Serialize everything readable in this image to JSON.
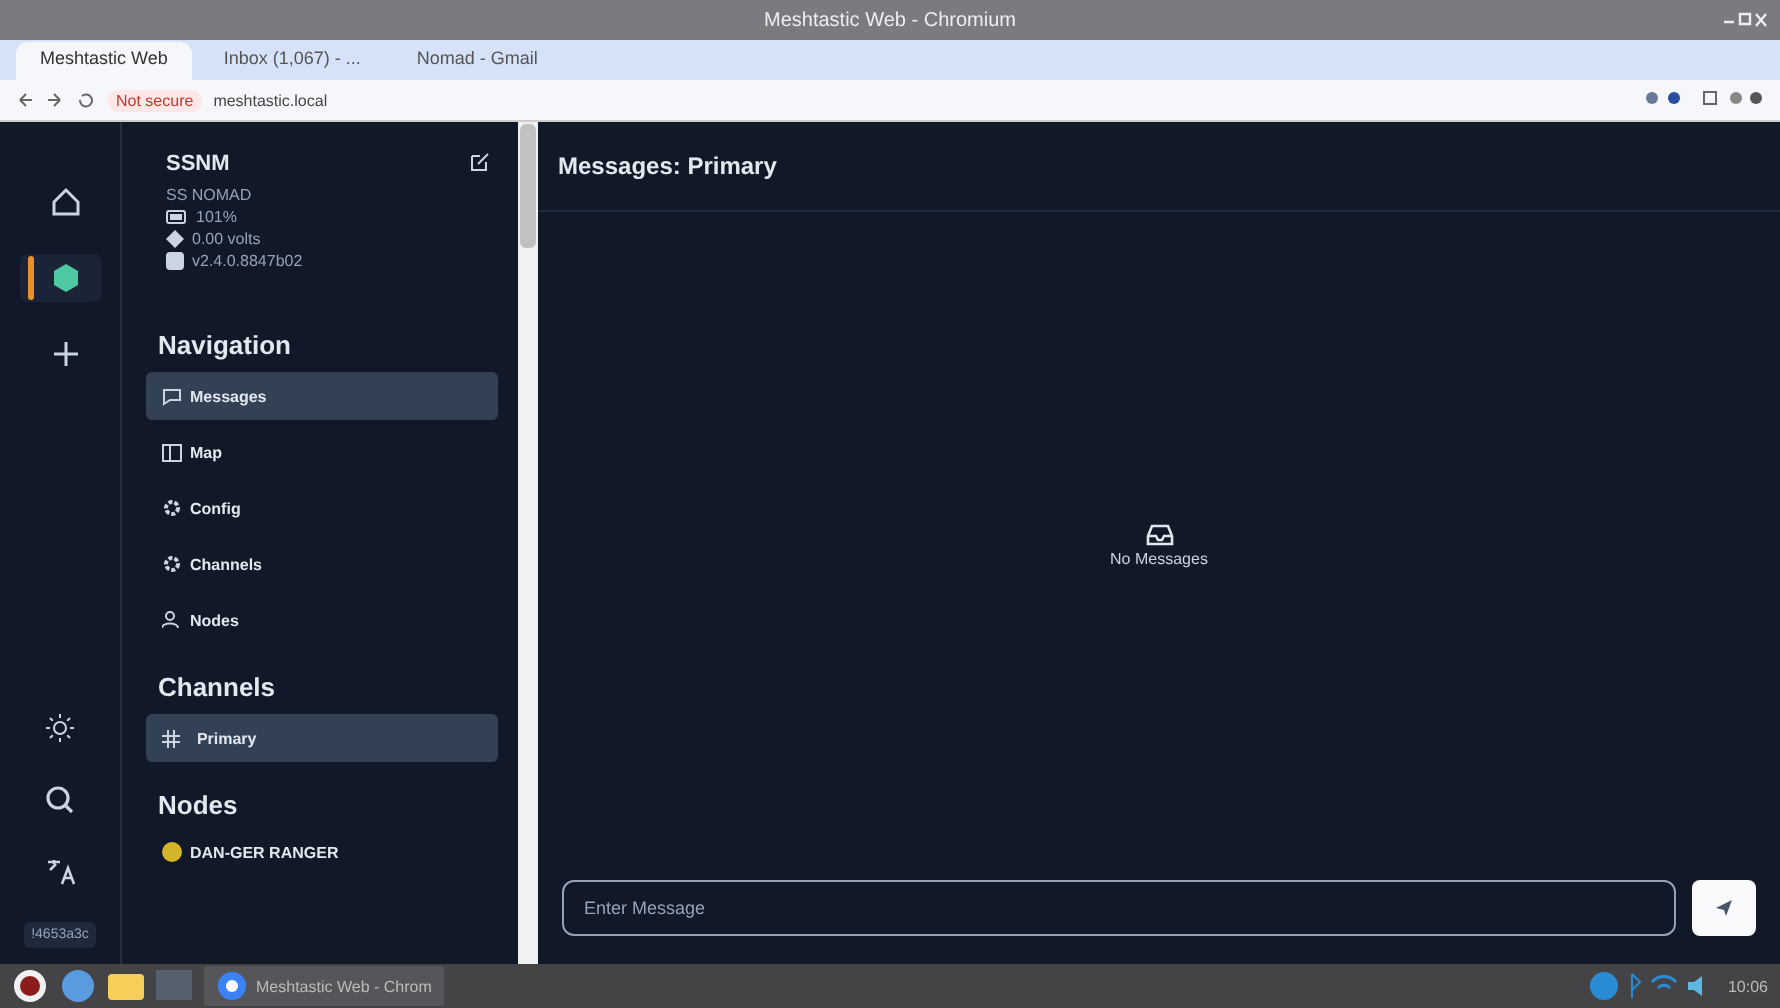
{
  "window": {
    "title": "Meshtastic Web - Chromium"
  },
  "browser_tabs": [
    {
      "label": "Meshtastic Web",
      "selected": true
    },
    {
      "label": "Inbox (1,067) - ...",
      "selected": false
    },
    {
      "label": "Nomad - Gmail",
      "selected": false
    }
  ],
  "address_bar": {
    "security": "Not secure",
    "url": "meshtastic.local"
  },
  "rail": {
    "items": [
      {
        "kind": "home",
        "selected": false
      },
      {
        "kind": "device",
        "selected": true
      },
      {
        "kind": "add",
        "selected": false
      }
    ],
    "node_id": "!4653a3c"
  },
  "device": {
    "short_name": "SSNM",
    "long_name": "SS NOMAD",
    "battery": "101%",
    "voltage": "0.00 volts",
    "firmware": "v2.4.0.8847b02"
  },
  "navigation": {
    "heading": "Navigation",
    "items": [
      {
        "label": "Messages",
        "selected": true
      },
      {
        "label": "Map",
        "selected": false
      },
      {
        "label": "Config",
        "selected": false
      },
      {
        "label": "Channels",
        "selected": false
      },
      {
        "label": "Nodes",
        "selected": false
      }
    ]
  },
  "channels": {
    "heading": "Channels",
    "items": [
      {
        "label": "Primary",
        "selected": true
      }
    ]
  },
  "nodes": {
    "heading": "Nodes",
    "items": [
      {
        "label": "DAN-GER RANGER",
        "color": "#d4b52a"
      }
    ]
  },
  "main": {
    "title": "Messages: Primary",
    "empty_text": "No Messages",
    "input": {
      "placeholder": "Enter Message"
    }
  },
  "taskbar": {
    "window_label": "Meshtastic Web - Chrom",
    "time": "10:06"
  }
}
